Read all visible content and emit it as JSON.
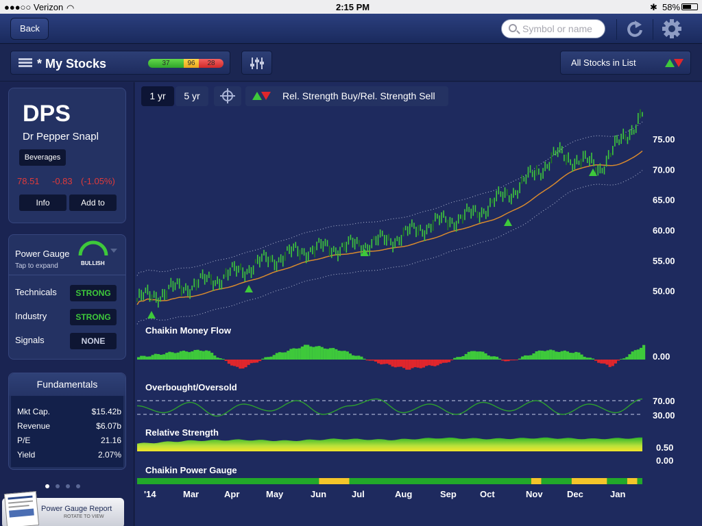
{
  "status": {
    "carrier": "●●●○○ Verizon",
    "time": "2:15 PM",
    "battery": "58%"
  },
  "nav": {
    "back": "Back",
    "search_placeholder": "Symbol or name"
  },
  "list": {
    "title": "* My Stocks",
    "bull": "37",
    "neutral": "96",
    "bear": "28",
    "filter": "All Stocks in List"
  },
  "stock": {
    "ticker": "DPS",
    "name": "Dr Pepper Snapl",
    "sector": "Beverages",
    "price": "78.51",
    "change": "-0.83",
    "change_pct": "(-1.05%)",
    "info_btn": "Info",
    "add_btn": "Add to"
  },
  "gauge": {
    "label": "Power Gauge",
    "hint": "Tap to expand",
    "rating": "BULLISH",
    "rows": [
      {
        "label": "Technicals",
        "value": "STRONG"
      },
      {
        "label": "Industry",
        "value": "STRONG"
      },
      {
        "label": "Signals",
        "value": "NONE"
      }
    ]
  },
  "fundamentals": {
    "title": "Fundamentals",
    "rows": [
      {
        "label": "Mkt Cap.",
        "value": "$15.42b"
      },
      {
        "label": "Revenue",
        "value": "$6.07b"
      },
      {
        "label": "P/E",
        "value": "21.16"
      },
      {
        "label": "Yield",
        "value": "2.07%"
      }
    ]
  },
  "report": {
    "title": "Power Gauge Report",
    "hint": "ROTATE TO VIEW"
  },
  "chart_controls": {
    "range_1": "1 yr",
    "range_2": "5 yr",
    "indicator": "Rel. Strength Buy/Rel. Strength Sell"
  },
  "colors": {
    "up": "#3ec93b",
    "down": "#e0262c",
    "neutral": "#f4c52a",
    "ma": "#d98a2e"
  },
  "chart_data": [
    {
      "type": "line",
      "title": "",
      "x_labels": [
        "'14",
        "Mar",
        "Apr",
        "May",
        "Jun",
        "Jul",
        "Aug",
        "Sep",
        "Oct",
        "Nov",
        "Dec",
        "Jan"
      ],
      "y_ticks": [
        "75.00",
        "70.00",
        "65.00",
        "60.00",
        "55.00",
        "50.00"
      ],
      "ylim": [
        46,
        81
      ],
      "series": [
        {
          "values": [
            48.5,
            50.5,
            52.2,
            54.8,
            56.8,
            57.3,
            58.4,
            61.0,
            62.6,
            66.8,
            72.5,
            70.4,
            79.0
          ]
        }
      ],
      "buy_signals": [
        "'14",
        "Apr",
        "Jul",
        "Oct",
        "Dec"
      ]
    },
    {
      "type": "area",
      "title": "Chaikin Money Flow",
      "y_ticks": [
        "0.00"
      ],
      "values": [
        0.05,
        0.15,
        0.2,
        -0.2,
        0.1,
        0.3,
        0.2,
        -0.05,
        -0.2,
        -0.1,
        0.2,
        -0.05,
        0.2,
        0.15,
        -0.15,
        0.3
      ]
    },
    {
      "type": "line",
      "title": "Overbought/Oversold",
      "y_ticks": [
        "70.00",
        "30.00"
      ],
      "values": [
        55,
        35,
        65,
        25,
        60,
        40,
        70,
        30,
        55,
        75,
        35,
        60,
        30,
        65,
        40,
        70,
        30,
        60,
        35,
        75
      ]
    },
    {
      "type": "area",
      "title": "Relative Strength",
      "y_ticks": [
        "0.50",
        "0.00"
      ],
      "values": [
        0.4,
        0.55,
        0.6,
        0.55,
        0.65,
        0.6,
        0.7,
        0.65,
        0.7,
        0.65,
        0.7
      ]
    },
    {
      "type": "heatmap",
      "title": "Chaikin Power Gauge",
      "segments": [
        {
          "state": "bullish",
          "share": 0.36
        },
        {
          "state": "neutral",
          "share": 0.06
        },
        {
          "state": "bullish",
          "share": 0.36
        },
        {
          "state": "neutral",
          "share": 0.02
        },
        {
          "state": "bullish",
          "share": 0.06
        },
        {
          "state": "neutral",
          "share": 0.07
        },
        {
          "state": "bullish",
          "share": 0.04
        },
        {
          "state": "neutral",
          "share": 0.02
        },
        {
          "state": "bullish",
          "share": 0.01
        }
      ]
    }
  ]
}
